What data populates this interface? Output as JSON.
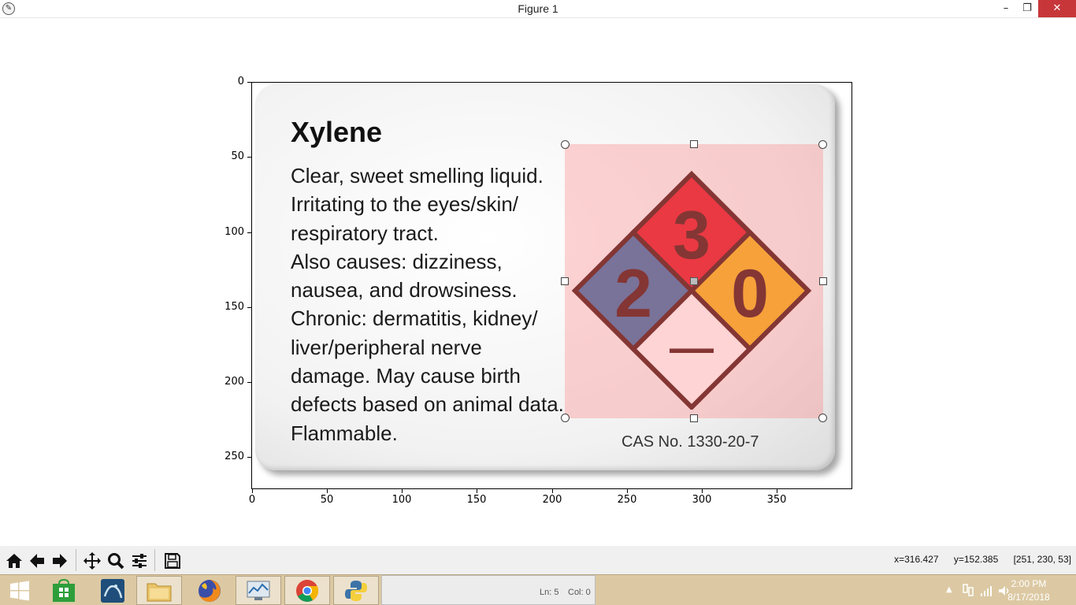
{
  "window": {
    "title": "Figure 1",
    "minimize_glyph": "–",
    "maximize_glyph": "❐",
    "close_glyph": "✕"
  },
  "axes": {
    "yticks": [
      "0",
      "50",
      "100",
      "150",
      "200",
      "250"
    ],
    "xticks": [
      "0",
      "50",
      "100",
      "150",
      "200",
      "250",
      "300",
      "350"
    ]
  },
  "image": {
    "title": "Xylene",
    "lines": [
      "Clear, sweet smelling liquid.",
      "Irritating to the eyes/skin/",
      "respiratory tract.",
      "Also causes: dizziness,",
      "nausea, and drowsiness.",
      "Chronic: dermatitis, kidney/",
      "liver/peripheral nerve",
      "damage. May cause birth",
      "defects based on animal data.",
      "Flammable."
    ],
    "cas": "CAS No. 1330-20-7",
    "nfpa": {
      "health": "2",
      "flammability": "3",
      "instability": "0",
      "special": "—",
      "colors": {
        "health": "#3a6fa8",
        "flammability": "#e11b2a",
        "instability": "#f2b41c",
        "special": "#ffffff",
        "outline": "#4a1714"
      }
    }
  },
  "toolbar": {
    "buttons": [
      "home-icon",
      "back-icon",
      "forward-icon",
      "pan-icon",
      "zoom-icon",
      "subplots-icon",
      "save-icon"
    ],
    "coord_x": "x=316.427",
    "coord_y": "y=152.385",
    "coord_rgb": "[251, 230, 53]"
  },
  "taskbar": {
    "items": [
      "windows-start-icon",
      "store-icon",
      "mysql-workbench-icon",
      "file-explorer-icon",
      "firefox-icon",
      "system-monitor-icon",
      "chrome-icon",
      "python-icon"
    ],
    "editor_line": "Ln: 5",
    "editor_col": "Col: 0",
    "time": "2:00 PM",
    "date": "8/17/2018"
  }
}
